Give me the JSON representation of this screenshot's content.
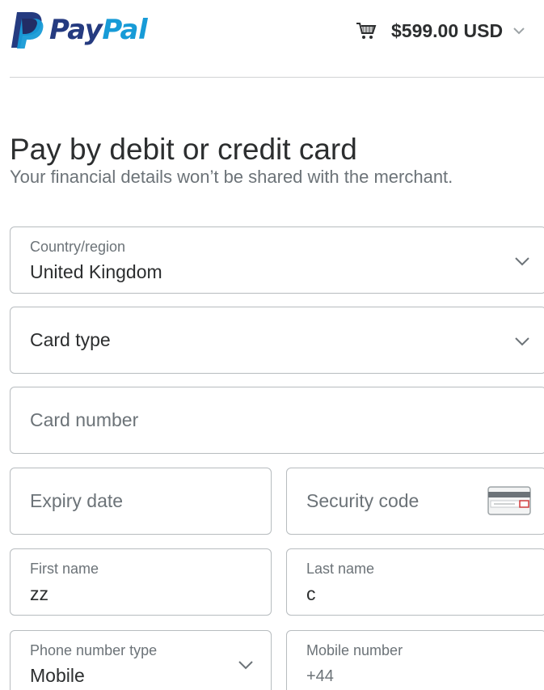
{
  "header": {
    "logo": {
      "part1": "Pay",
      "part2": "Pal",
      "icon": "paypal-p-icon"
    },
    "cart": {
      "icon": "shopping-cart-icon",
      "amount": "$599.00 USD",
      "chevron": "chevron-down-icon"
    }
  },
  "page": {
    "title": "Pay by debit or credit card",
    "subtitle": "Your financial details won’t be shared with the merchant."
  },
  "form": {
    "country": {
      "label": "Country/region",
      "value": "United Kingdom"
    },
    "card_type": {
      "placeholder": "Card type"
    },
    "card_number": {
      "placeholder": "Card number"
    },
    "expiry": {
      "placeholder": "Expiry date"
    },
    "security_code": {
      "placeholder": "Security code",
      "icon": "card-cvv-icon"
    },
    "first_name": {
      "label": "First name",
      "value": "zz"
    },
    "last_name": {
      "label": "Last name",
      "value": "c"
    },
    "phone_type": {
      "label": "Phone number type",
      "value": "Mobile"
    },
    "mobile_number": {
      "label": "Mobile number",
      "prefix": "+44"
    }
  },
  "colors": {
    "brand_dark": "#253b80",
    "brand_light": "#179bd7",
    "text": "#2c2e2f",
    "muted": "#6c7378",
    "border": "#b7bcbf"
  }
}
